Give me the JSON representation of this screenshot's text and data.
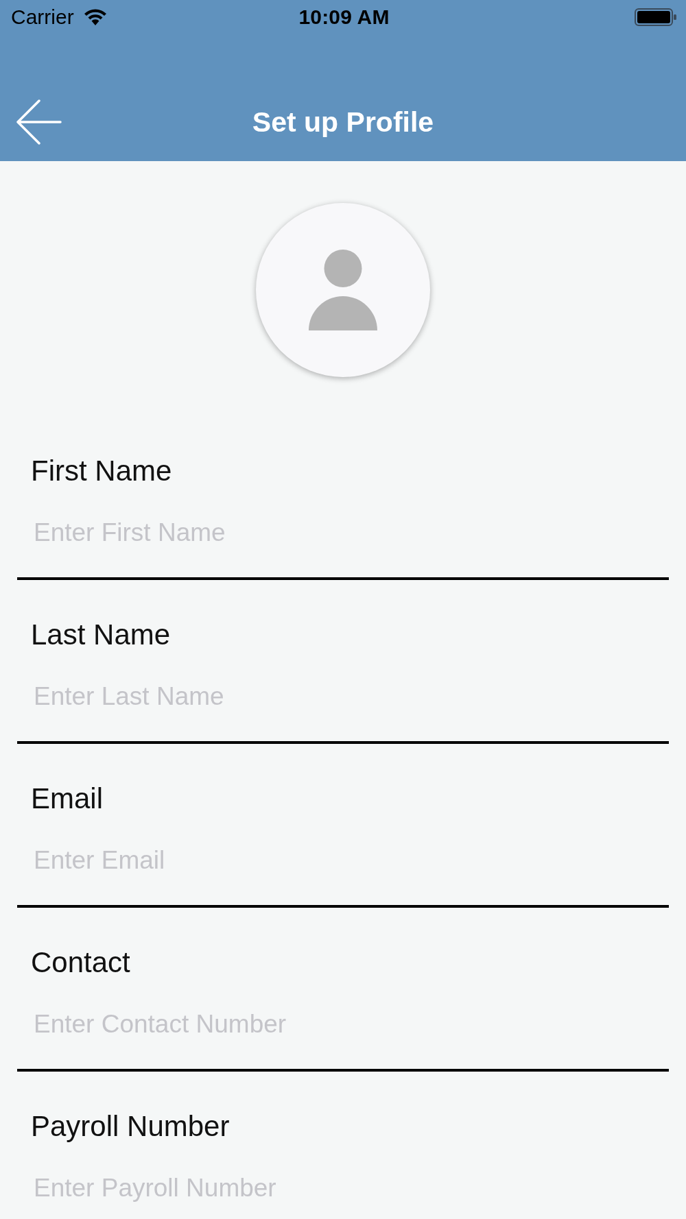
{
  "status_bar": {
    "carrier": "Carrier",
    "time": "10:09 AM"
  },
  "header": {
    "title": "Set up Profile"
  },
  "form": {
    "fields": [
      {
        "label": "First Name",
        "placeholder": "Enter First Name"
      },
      {
        "label": "Last Name",
        "placeholder": "Enter Last Name"
      },
      {
        "label": "Email",
        "placeholder": "Enter Email"
      },
      {
        "label": "Contact",
        "placeholder": "Enter Contact Number"
      },
      {
        "label": "Payroll Number",
        "placeholder": "Enter Payroll Number"
      }
    ]
  }
}
